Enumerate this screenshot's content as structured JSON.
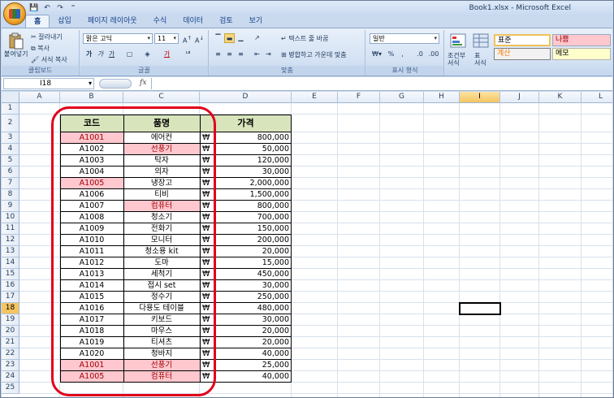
{
  "window": {
    "title": "Book1.xlsx  -  Microsoft Excel"
  },
  "quick_access": [
    "💾",
    "↶",
    "↷",
    "⁼"
  ],
  "tabs": [
    "홈",
    "삽입",
    "페이지 레이아웃",
    "수식",
    "데이터",
    "검토",
    "보기"
  ],
  "ribbon": {
    "clipboard": {
      "paste": "붙여넣기",
      "cut": "잘라내기",
      "copy": "복사",
      "format_painter": "서식 복사",
      "label": "클립보드"
    },
    "font": {
      "name": "맑은 고딕",
      "size": "11",
      "label": "글꼴"
    },
    "alignment": {
      "wrap": "텍스트 줄 바꿈",
      "merge": "병합하고 가운데 맞춤",
      "label": "맞춤"
    },
    "number": {
      "format": "일반",
      "label": "표시 형식"
    },
    "styles": {
      "cond": "조건부\n서식",
      "table": "표\n서식",
      "s1": "표준",
      "s2": "나쁨",
      "s3": "계산",
      "s4": "메모"
    }
  },
  "formula_bar": {
    "name_box": "I18",
    "fx": "fx",
    "value": ""
  },
  "columns": [
    "A",
    "B",
    "C",
    "D",
    "E",
    "F",
    "G",
    "H",
    "I",
    "J",
    "K",
    "L"
  ],
  "selected_column": "I",
  "selected_row": "18",
  "table": {
    "headers": [
      "코드",
      "품명",
      "가격"
    ],
    "currency": "₩",
    "rows": [
      {
        "row": "3",
        "code": "A1001",
        "name": "에어컨",
        "price": "800,000",
        "hl_code": true,
        "hl_name": false
      },
      {
        "row": "4",
        "code": "A1002",
        "name": "선풍기",
        "price": "50,000",
        "hl_code": false,
        "hl_name": true
      },
      {
        "row": "5",
        "code": "A1003",
        "name": "탁자",
        "price": "120,000",
        "hl_code": false,
        "hl_name": false
      },
      {
        "row": "6",
        "code": "A1004",
        "name": "의자",
        "price": "30,000",
        "hl_code": false,
        "hl_name": false
      },
      {
        "row": "7",
        "code": "A1005",
        "name": "냉장고",
        "price": "2,000,000",
        "hl_code": true,
        "hl_name": false
      },
      {
        "row": "8",
        "code": "A1006",
        "name": "티비",
        "price": "1,500,000",
        "hl_code": false,
        "hl_name": false
      },
      {
        "row": "9",
        "code": "A1007",
        "name": "컴퓨터",
        "price": "800,000",
        "hl_code": false,
        "hl_name": true
      },
      {
        "row": "10",
        "code": "A1008",
        "name": "청소기",
        "price": "700,000",
        "hl_code": false,
        "hl_name": false
      },
      {
        "row": "11",
        "code": "A1009",
        "name": "전화기",
        "price": "150,000",
        "hl_code": false,
        "hl_name": false
      },
      {
        "row": "12",
        "code": "A1010",
        "name": "모니터",
        "price": "200,000",
        "hl_code": false,
        "hl_name": false
      },
      {
        "row": "13",
        "code": "A1011",
        "name": "청소용 kit",
        "price": "20,000",
        "hl_code": false,
        "hl_name": false
      },
      {
        "row": "14",
        "code": "A1012",
        "name": "도마",
        "price": "15,000",
        "hl_code": false,
        "hl_name": false
      },
      {
        "row": "15",
        "code": "A1013",
        "name": "세척기",
        "price": "450,000",
        "hl_code": false,
        "hl_name": false
      },
      {
        "row": "16",
        "code": "A1014",
        "name": "접시 set",
        "price": "30,000",
        "hl_code": false,
        "hl_name": false
      },
      {
        "row": "17",
        "code": "A1015",
        "name": "정수기",
        "price": "250,000",
        "hl_code": false,
        "hl_name": false
      },
      {
        "row": "18",
        "code": "A1016",
        "name": "다용도 테이블",
        "price": "480,000",
        "hl_code": false,
        "hl_name": false
      },
      {
        "row": "19",
        "code": "A1017",
        "name": "키보드",
        "price": "30,000",
        "hl_code": false,
        "hl_name": false
      },
      {
        "row": "20",
        "code": "A1018",
        "name": "마우스",
        "price": "20,000",
        "hl_code": false,
        "hl_name": false
      },
      {
        "row": "21",
        "code": "A1019",
        "name": "티셔츠",
        "price": "20,000",
        "hl_code": false,
        "hl_name": false
      },
      {
        "row": "22",
        "code": "A1020",
        "name": "청바지",
        "price": "40,000",
        "hl_code": false,
        "hl_name": false
      },
      {
        "row": "23",
        "code": "A1001",
        "name": "선풍기",
        "price": "25,000",
        "hl_code": true,
        "hl_name": true
      },
      {
        "row": "24",
        "code": "A1005",
        "name": "컴퓨터",
        "price": "40,000",
        "hl_code": true,
        "hl_name": true
      }
    ]
  },
  "all_rows": [
    "1",
    "2",
    "3",
    "4",
    "5",
    "6",
    "7",
    "8",
    "9",
    "10",
    "11",
    "12",
    "13",
    "14",
    "15",
    "16",
    "17",
    "18",
    "19",
    "20",
    "21",
    "22",
    "23",
    "24",
    "25"
  ],
  "colors": {
    "highlight_fill": "#ffc7ce",
    "highlight_text": "#9c0006",
    "header_fill": "#d8e4bc",
    "annotation": "#e0001b"
  }
}
